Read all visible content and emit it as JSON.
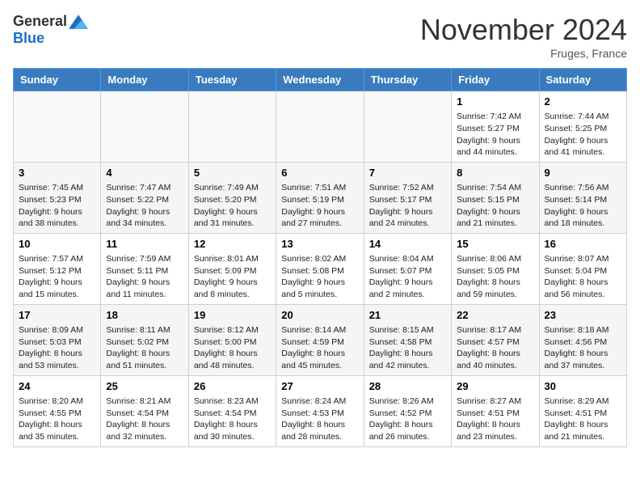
{
  "logo": {
    "general": "General",
    "blue": "Blue"
  },
  "title": "November 2024",
  "location": "Fruges, France",
  "days_of_week": [
    "Sunday",
    "Monday",
    "Tuesday",
    "Wednesday",
    "Thursday",
    "Friday",
    "Saturday"
  ],
  "weeks": [
    [
      {
        "day": "",
        "info": ""
      },
      {
        "day": "",
        "info": ""
      },
      {
        "day": "",
        "info": ""
      },
      {
        "day": "",
        "info": ""
      },
      {
        "day": "",
        "info": ""
      },
      {
        "day": "1",
        "info": "Sunrise: 7:42 AM\nSunset: 5:27 PM\nDaylight: 9 hours and 44 minutes."
      },
      {
        "day": "2",
        "info": "Sunrise: 7:44 AM\nSunset: 5:25 PM\nDaylight: 9 hours and 41 minutes."
      }
    ],
    [
      {
        "day": "3",
        "info": "Sunrise: 7:45 AM\nSunset: 5:23 PM\nDaylight: 9 hours and 38 minutes."
      },
      {
        "day": "4",
        "info": "Sunrise: 7:47 AM\nSunset: 5:22 PM\nDaylight: 9 hours and 34 minutes."
      },
      {
        "day": "5",
        "info": "Sunrise: 7:49 AM\nSunset: 5:20 PM\nDaylight: 9 hours and 31 minutes."
      },
      {
        "day": "6",
        "info": "Sunrise: 7:51 AM\nSunset: 5:19 PM\nDaylight: 9 hours and 27 minutes."
      },
      {
        "day": "7",
        "info": "Sunrise: 7:52 AM\nSunset: 5:17 PM\nDaylight: 9 hours and 24 minutes."
      },
      {
        "day": "8",
        "info": "Sunrise: 7:54 AM\nSunset: 5:15 PM\nDaylight: 9 hours and 21 minutes."
      },
      {
        "day": "9",
        "info": "Sunrise: 7:56 AM\nSunset: 5:14 PM\nDaylight: 9 hours and 18 minutes."
      }
    ],
    [
      {
        "day": "10",
        "info": "Sunrise: 7:57 AM\nSunset: 5:12 PM\nDaylight: 9 hours and 15 minutes."
      },
      {
        "day": "11",
        "info": "Sunrise: 7:59 AM\nSunset: 5:11 PM\nDaylight: 9 hours and 11 minutes."
      },
      {
        "day": "12",
        "info": "Sunrise: 8:01 AM\nSunset: 5:09 PM\nDaylight: 9 hours and 8 minutes."
      },
      {
        "day": "13",
        "info": "Sunrise: 8:02 AM\nSunset: 5:08 PM\nDaylight: 9 hours and 5 minutes."
      },
      {
        "day": "14",
        "info": "Sunrise: 8:04 AM\nSunset: 5:07 PM\nDaylight: 9 hours and 2 minutes."
      },
      {
        "day": "15",
        "info": "Sunrise: 8:06 AM\nSunset: 5:05 PM\nDaylight: 8 hours and 59 minutes."
      },
      {
        "day": "16",
        "info": "Sunrise: 8:07 AM\nSunset: 5:04 PM\nDaylight: 8 hours and 56 minutes."
      }
    ],
    [
      {
        "day": "17",
        "info": "Sunrise: 8:09 AM\nSunset: 5:03 PM\nDaylight: 8 hours and 53 minutes."
      },
      {
        "day": "18",
        "info": "Sunrise: 8:11 AM\nSunset: 5:02 PM\nDaylight: 8 hours and 51 minutes."
      },
      {
        "day": "19",
        "info": "Sunrise: 8:12 AM\nSunset: 5:00 PM\nDaylight: 8 hours and 48 minutes."
      },
      {
        "day": "20",
        "info": "Sunrise: 8:14 AM\nSunset: 4:59 PM\nDaylight: 8 hours and 45 minutes."
      },
      {
        "day": "21",
        "info": "Sunrise: 8:15 AM\nSunset: 4:58 PM\nDaylight: 8 hours and 42 minutes."
      },
      {
        "day": "22",
        "info": "Sunrise: 8:17 AM\nSunset: 4:57 PM\nDaylight: 8 hours and 40 minutes."
      },
      {
        "day": "23",
        "info": "Sunrise: 8:18 AM\nSunset: 4:56 PM\nDaylight: 8 hours and 37 minutes."
      }
    ],
    [
      {
        "day": "24",
        "info": "Sunrise: 8:20 AM\nSunset: 4:55 PM\nDaylight: 8 hours and 35 minutes."
      },
      {
        "day": "25",
        "info": "Sunrise: 8:21 AM\nSunset: 4:54 PM\nDaylight: 8 hours and 32 minutes."
      },
      {
        "day": "26",
        "info": "Sunrise: 8:23 AM\nSunset: 4:54 PM\nDaylight: 8 hours and 30 minutes."
      },
      {
        "day": "27",
        "info": "Sunrise: 8:24 AM\nSunset: 4:53 PM\nDaylight: 8 hours and 28 minutes."
      },
      {
        "day": "28",
        "info": "Sunrise: 8:26 AM\nSunset: 4:52 PM\nDaylight: 8 hours and 26 minutes."
      },
      {
        "day": "29",
        "info": "Sunrise: 8:27 AM\nSunset: 4:51 PM\nDaylight: 8 hours and 23 minutes."
      },
      {
        "day": "30",
        "info": "Sunrise: 8:29 AM\nSunset: 4:51 PM\nDaylight: 8 hours and 21 minutes."
      }
    ]
  ]
}
